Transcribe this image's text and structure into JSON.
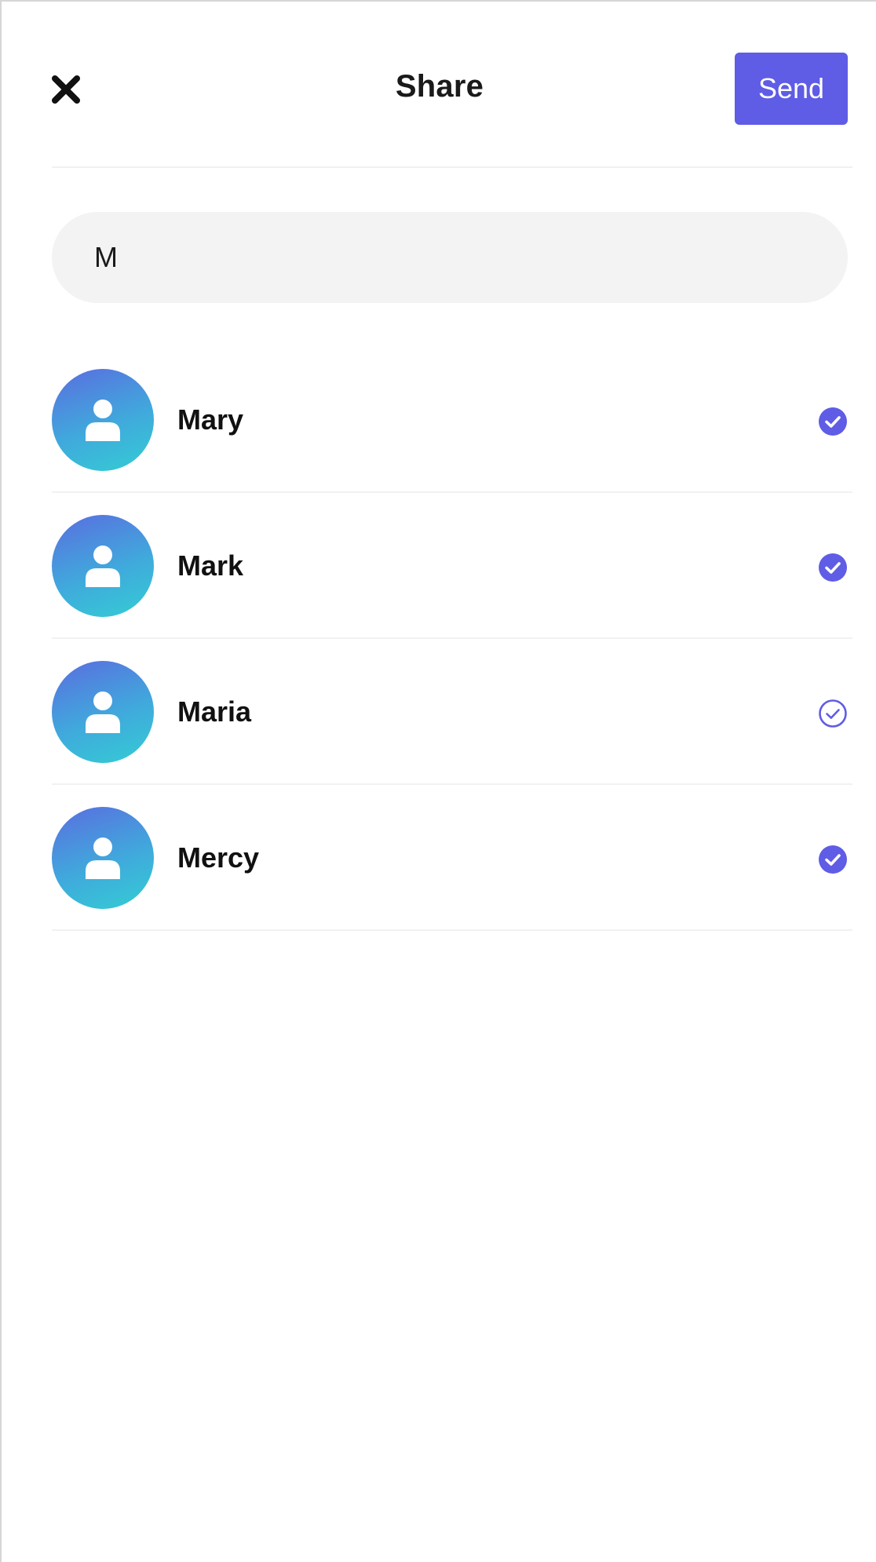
{
  "header": {
    "title": "Share",
    "send_label": "Send",
    "close_icon": "close-icon"
  },
  "search": {
    "value": "M"
  },
  "contacts": [
    {
      "name": "Mary",
      "selected": true
    },
    {
      "name": "Mark",
      "selected": true
    },
    {
      "name": "Maria",
      "selected": false
    },
    {
      "name": "Mercy",
      "selected": true
    }
  ],
  "colors": {
    "accent": "#5f5ce6",
    "avatar_start": "#5a6de0",
    "avatar_end": "#33cdd4"
  }
}
